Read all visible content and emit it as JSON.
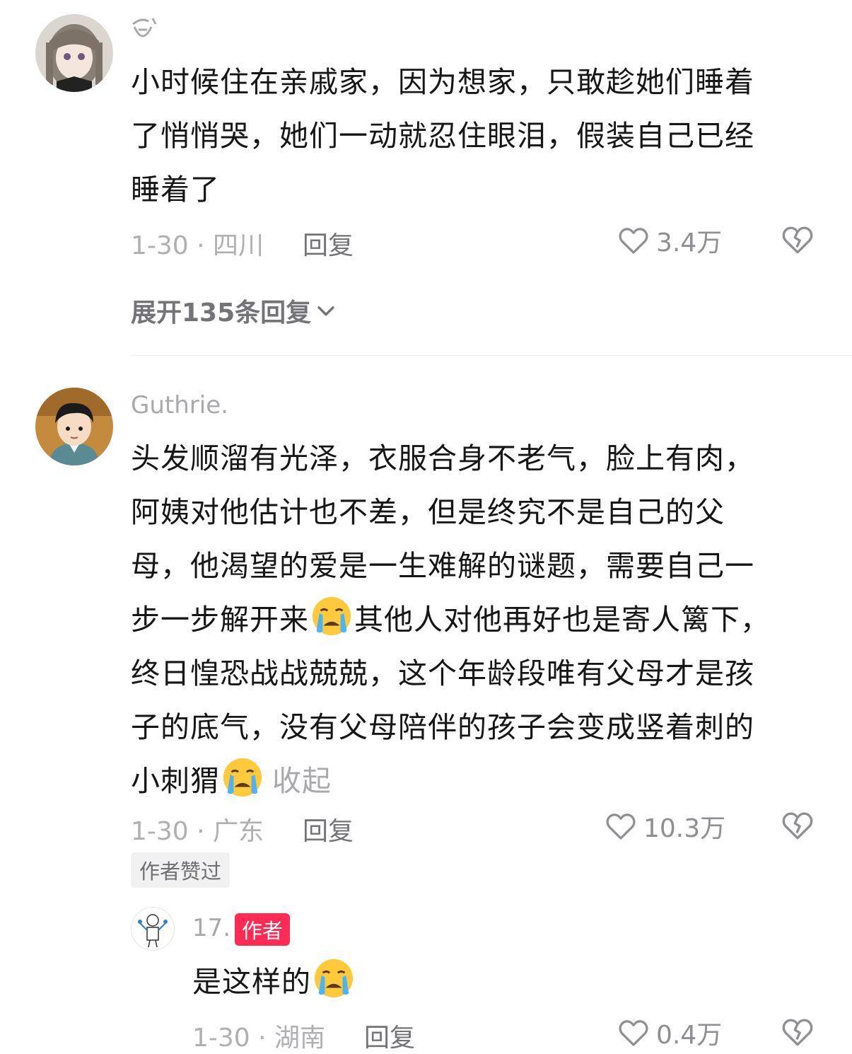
{
  "comments": [
    {
      "username": "",
      "text_lines": [
        "小时候住在亲戚家，因为想家，只敢趁她们睡着",
        "了悄悄哭，她们一动就忍住眼泪，假装自己已经",
        "睡着了"
      ],
      "date_region": "1-30 · 四川",
      "reply_label": "回复",
      "likes": "3.4万",
      "expand_label": "展开135条回复"
    },
    {
      "username": "Guthrie.",
      "text_lines": [
        "头发顺溜有光泽，衣服合身不老气，脸上有肉，",
        "阿姨对他估计也不差，但是终究不是自己的父",
        "母，他渴望的爱是一生难解的谜题，需要自己一"
      ],
      "line4_before": "步一步解开来",
      "line4_after": "其他人对他再好也是寄人篱下，",
      "text_lines2": [
        "终日惶恐战战兢兢，这个年龄段唯有父母才是孩",
        "子的底气，没有父母陪伴的孩子会变成竖着刺的"
      ],
      "last_line": "小刺猬",
      "collapse_label": "收起",
      "date_region": "1-30 · 广东",
      "reply_label": "回复",
      "likes": "10.3万",
      "author_liked": "作者赞过"
    }
  ],
  "reply": {
    "username": "17.",
    "author_tag": "作者",
    "text": "是这样的",
    "date_region": "1-30 · 湖南",
    "reply_label": "回复",
    "likes": "0.4万"
  },
  "colors": {
    "accent": "#fe2c55",
    "text": "#161616",
    "meta": "#b0b0b4"
  },
  "icons": {
    "like": "heart-outline-icon",
    "dislike": "broken-heart-icon",
    "expand": "chevron-down-icon",
    "emoji": "crying-face-emoji"
  }
}
